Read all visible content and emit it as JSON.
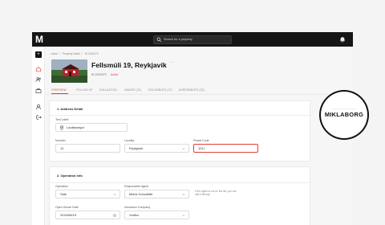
{
  "topbar": {
    "logo": "M",
    "search_placeholder": "Search for a property",
    "search_icon": "search-icon",
    "bell_icon": "bell-icon"
  },
  "sidebar": {
    "add_label": "+",
    "icons": [
      "home-icon",
      "users-icon",
      "briefcase-icon",
      "user-icon",
      "logout-icon"
    ]
  },
  "breadcrumb": [
    "Listed",
    "Property Detail",
    "ID 2315373"
  ],
  "property": {
    "title": "Fellsmúli 19, Reykjavík",
    "more": "···",
    "id_label": "ID 2315373",
    "status": "Active"
  },
  "tabs": [
    {
      "label": "OVERVIEW",
      "active": true
    },
    {
      "label": "FOLLOW-UP",
      "active": false
    },
    {
      "label": "EVALUATION",
      "active": false
    },
    {
      "label": "IMAGES (32)",
      "active": false
    },
    {
      "label": "DOCUMENTS (27)",
      "active": false
    },
    {
      "label": "AGREEMENTS (32)",
      "active": false
    }
  ],
  "address": {
    "title": "1. Address Detail",
    "text_label": "Text Label",
    "text_value": "Laufásvegur",
    "number_label": "Number",
    "number_value": "12",
    "locality_label": "Locality",
    "locality_value": "Reykjavík",
    "postal_label": "Postal Code",
    "postal_value": "101|"
  },
  "operation": {
    "title": "2. Operation info",
    "operation_label": "Operation",
    "operation_value": "Sale",
    "agent_label": "Responsible Agent",
    "agent_value": "María Gonzálitte",
    "hint": "If the agent is not on the list, you can add it directly",
    "open_house_label": "Open House Date",
    "open_house_value": "2024/08/15",
    "insurance_label": "Insurance Company",
    "insurance_value": "Vodfux"
  },
  "badge": {
    "small": "──── ────── ────",
    "name": "MIKLABORG"
  },
  "colors": {
    "accent": "#e2403a",
    "dark": "#151515"
  }
}
